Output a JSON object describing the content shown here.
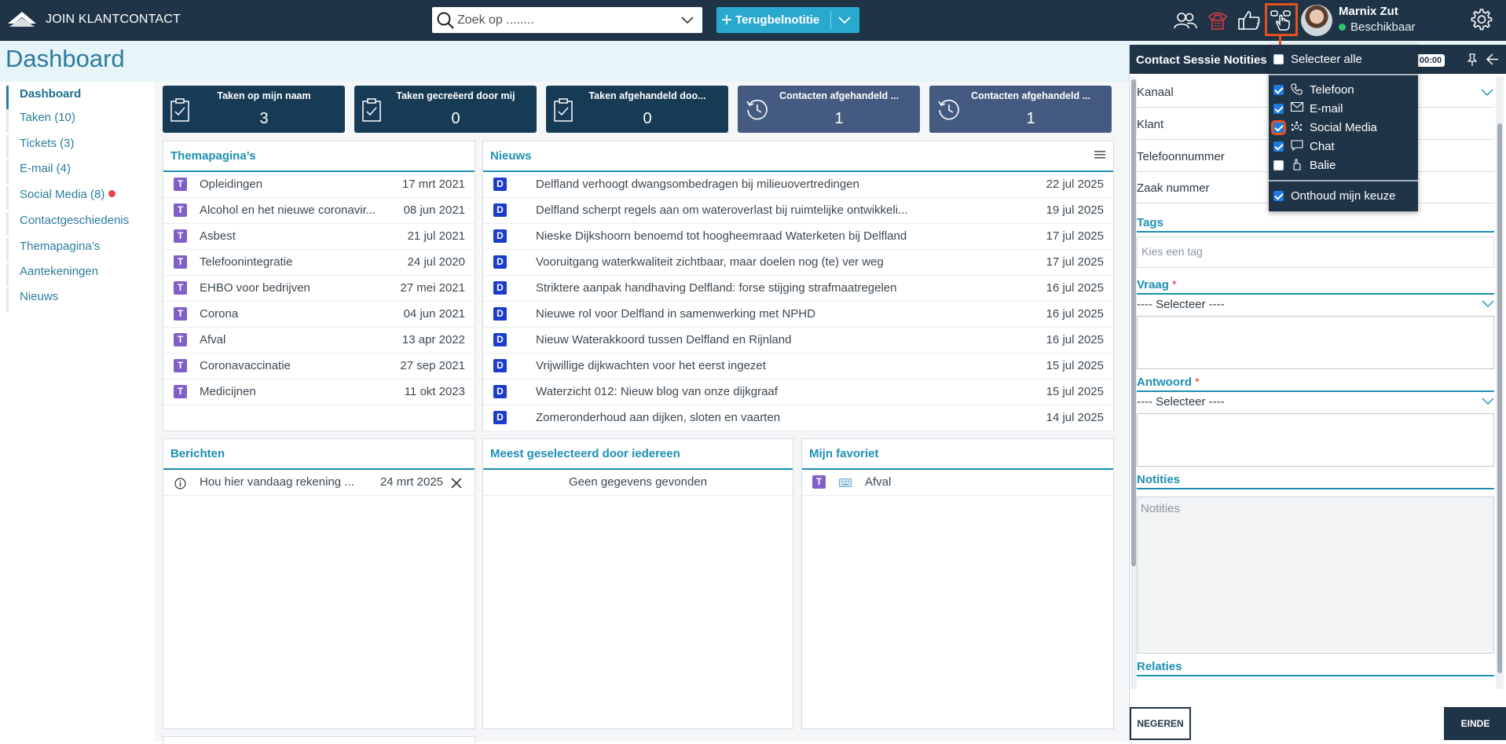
{
  "app": {
    "name": "JOIN KLANTCONTACT"
  },
  "search": {
    "placeholder": "Zoek op ........"
  },
  "new_button": {
    "label": "Terugbelnotitie"
  },
  "user": {
    "name": "Marnix Zut",
    "status": "Beschikbaar",
    "status_color": "#28c76f"
  },
  "page": {
    "title": "Dashboard"
  },
  "sidebar": {
    "items": [
      {
        "label": "Dashboard",
        "active": true
      },
      {
        "label": "Taken (10)"
      },
      {
        "label": "Tickets (3)"
      },
      {
        "label": "E-mail (4)"
      },
      {
        "label": "Social Media (8)",
        "notification": true
      },
      {
        "label": "Contactgeschiedenis"
      },
      {
        "label": "Themapagina’s"
      },
      {
        "label": "Aantekeningen"
      },
      {
        "label": "Nieuws"
      }
    ]
  },
  "tiles": [
    {
      "title": "Taken op mijn naam",
      "value": "3",
      "icon": "clipboard-check-icon"
    },
    {
      "title": "Taken gecreëerd door mij",
      "value": "0",
      "icon": "clipboard-check-icon"
    },
    {
      "title": "Taken afgehandeld doo...",
      "value": "0",
      "icon": "clipboard-check-icon"
    },
    {
      "title": "Contacten afgehandeld ...",
      "value": "1",
      "icon": "history-icon"
    },
    {
      "title": "Contacten afgehandeld ...",
      "value": "1",
      "icon": "history-icon"
    }
  ],
  "themapaginas": {
    "title": "Themapagina’s",
    "rows": [
      {
        "badge": "T",
        "title": "Opleidingen",
        "date": "17 mrt 2021"
      },
      {
        "badge": "T",
        "title": "Alcohol en het nieuwe coronavir...",
        "date": "08 jun 2021"
      },
      {
        "badge": "T",
        "title": "Asbest",
        "date": "21 jul 2021"
      },
      {
        "badge": "T",
        "title": "Telefoonintegratie",
        "date": "24 jul 2020"
      },
      {
        "badge": "T",
        "title": "EHBO voor bedrijven",
        "date": "27 mei 2021"
      },
      {
        "badge": "T",
        "title": "Corona",
        "date": "04 jun 2021"
      },
      {
        "badge": "T",
        "title": "Afval",
        "date": "13 apr 2022"
      },
      {
        "badge": "T",
        "title": "Coronavaccinatie",
        "date": "27 sep 2021"
      },
      {
        "badge": "T",
        "title": "Medicijnen",
        "date": "11 okt 2023"
      }
    ]
  },
  "nieuws": {
    "title": "Nieuws",
    "rows": [
      {
        "badge": "D",
        "title": "Delfland verhoogt dwangsombedragen bij milieuovertredingen",
        "date": "22 jul 2025"
      },
      {
        "badge": "D",
        "title": "Delfland scherpt regels aan om wateroverlast bij ruimtelijke ontwikkeli...",
        "date": "19 jul 2025"
      },
      {
        "badge": "D",
        "title": "Nieske Dijkshoorn benoemd tot hoogheemraad Waterketen bij Delfland",
        "date": "17 jul 2025"
      },
      {
        "badge": "D",
        "title": "Vooruitgang waterkwaliteit zichtbaar, maar doelen nog (te) ver weg",
        "date": "17 jul 2025"
      },
      {
        "badge": "D",
        "title": "Striktere aanpak handhaving Delfland: forse stijging strafmaatregelen",
        "date": "16 jul 2025"
      },
      {
        "badge": "D",
        "title": "Nieuwe rol voor Delfland in samenwerking met NPHD",
        "date": "16 jul 2025"
      },
      {
        "badge": "D",
        "title": "Nieuw Waterakkoord tussen Delfland en Rijnland",
        "date": "16 jul 2025"
      },
      {
        "badge": "D",
        "title": "Vrijwillige dijkwachten voor het eerst ingezet",
        "date": "15 jul 2025"
      },
      {
        "badge": "D",
        "title": "Waterzicht 012: Nieuw blog van onze dijkgraaf",
        "date": "15 jul 2025"
      },
      {
        "badge": "D",
        "title": "Zomeronderhoud aan dijken, sloten en vaarten",
        "date": "14 jul 2025"
      }
    ]
  },
  "berichten": {
    "title": "Berichten",
    "rows": [
      {
        "title": "Hou hier vandaag rekening ...",
        "date": "24 mrt 2025"
      }
    ]
  },
  "meest": {
    "title": "Meest geselecteerd door iedereen",
    "empty": "Geen gegevens gevonden"
  },
  "favoriet": {
    "title": "Mijn favoriet",
    "rows": [
      {
        "badge": "T",
        "title": "Afval"
      }
    ]
  },
  "session": {
    "title": "Contact Sessie Notities",
    "timer": "00:00",
    "fields": [
      "Kanaal",
      "Klant",
      "Telefoonnummer",
      "Zaak nummer"
    ],
    "tags_label": "Tags",
    "tags_placeholder": "Kies een tag",
    "vraag_label": "Vraag",
    "vraag_select": "---- Selecteer ----",
    "antwoord_label": "Antwoord",
    "antwoord_select": "---- Selecteer ----",
    "notities_label": "Notities",
    "notities_placeholder": "Notities",
    "relaties_label": "Relaties",
    "required_mark": "*",
    "ignore_label": "NEGEREN",
    "end_label": "EINDE"
  },
  "channel_menu": {
    "select_all": "Selecteer alle",
    "select_all_checked": false,
    "channels": [
      {
        "label": "Telefoon",
        "checked": true,
        "icon": "phone-icon"
      },
      {
        "label": "E-mail",
        "checked": true,
        "icon": "envelope-icon"
      },
      {
        "label": "Social Media",
        "checked": true,
        "icon": "network-icon"
      },
      {
        "label": "Chat",
        "checked": true,
        "icon": "chat-bubble-icon"
      },
      {
        "label": "Balie",
        "checked": false,
        "icon": "hand-bell-icon"
      }
    ],
    "remember": "Onthoud mijn keuze",
    "remember_checked": true
  },
  "colors": {
    "navy": "#1f3447",
    "accent": "#1d8fb3",
    "highlight": "#e3521f",
    "tile_dark": "#173b55",
    "tile_purple": "#455a80"
  }
}
